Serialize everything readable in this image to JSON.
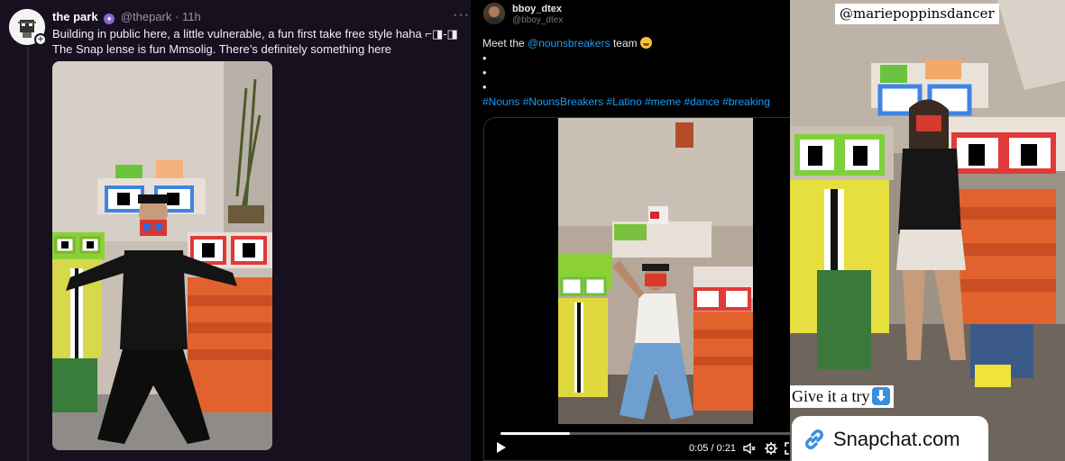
{
  "cast": {
    "display_name": "the park",
    "handle": "@thepark",
    "separator": "·",
    "age": "11h",
    "more_label": "···",
    "text": "Building in public here, a little vulnerable, a fun first take free style haha ⌐◨-◨ The Snap lense is fun Mmsolig. There’s definitely something here"
  },
  "tweet": {
    "display_name": "bboy_dtex",
    "handle": "@bboy_dtex",
    "intro_text": "Meet the ",
    "mention": "@nounsbreakers",
    "intro_suffix": " team ",
    "bullets": [
      "•",
      "•",
      "•"
    ],
    "hashtags": "#Nouns #NounsBreakers #Latino #meme #dance #breaking",
    "video": {
      "current_time": "0:05",
      "time_separator": " / ",
      "duration": "0:21",
      "progress_fraction": 0.238
    }
  },
  "story": {
    "user_tag": "@mariepoppinsdancer",
    "cta_text": "Give it a try",
    "link_text": "Snapchat.com"
  },
  "colors": {
    "cast_bg": "#17101f",
    "link_blue": "#1d9bf0",
    "badge_purple": "#8a63d2"
  },
  "icons": [
    "add-icon",
    "verified-badge-icon",
    "more-options-icon",
    "emoji-icon",
    "play-icon",
    "volume-icon",
    "settings-gear-icon",
    "fullscreen-icon",
    "down-arrow-emoji-icon",
    "link-icon"
  ]
}
